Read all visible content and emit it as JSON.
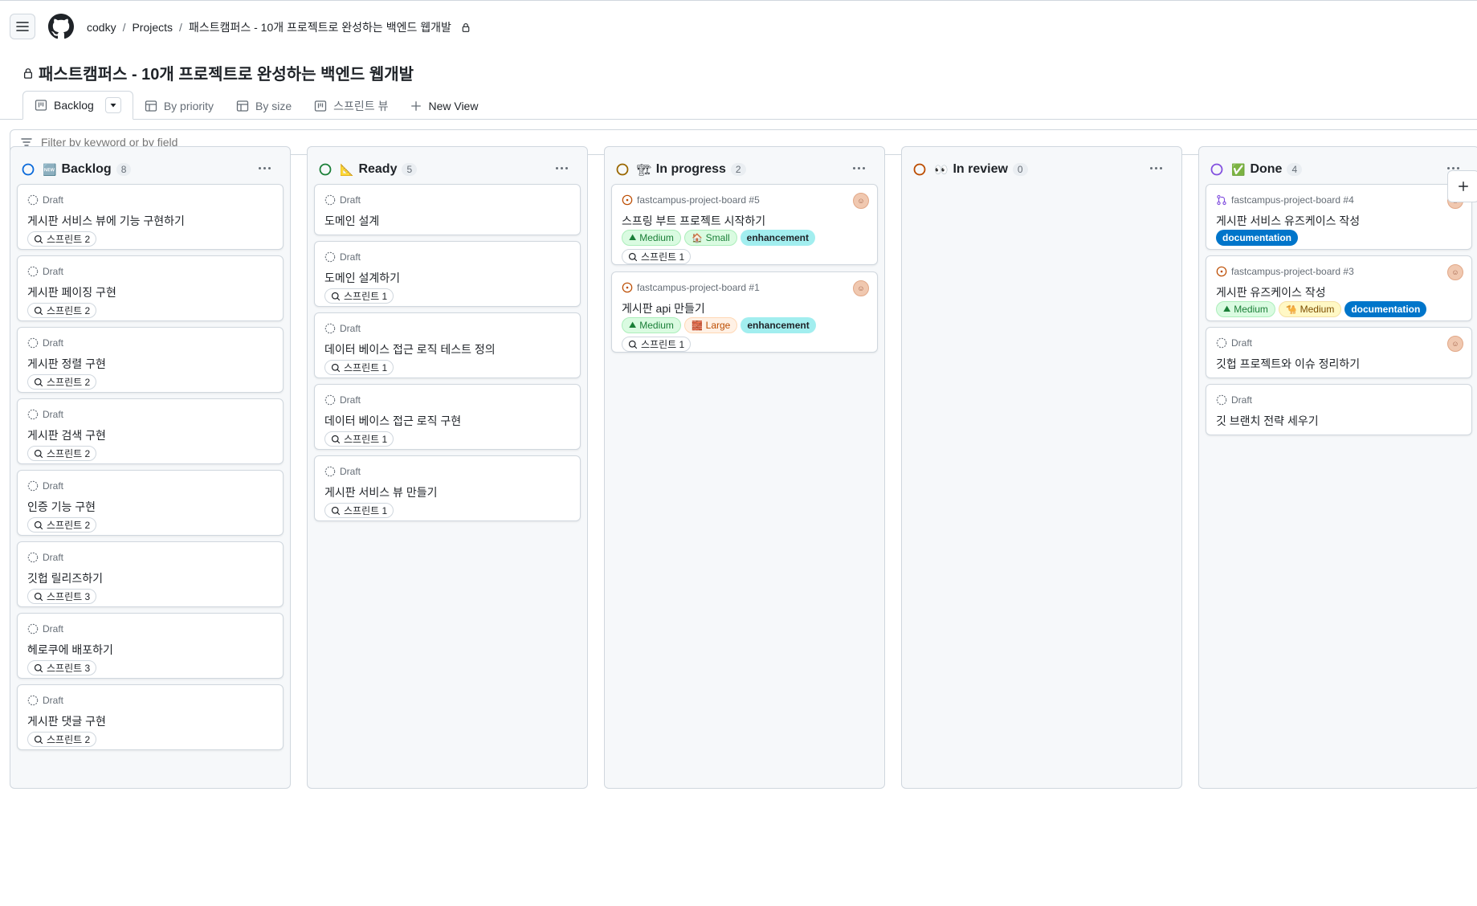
{
  "header": {
    "breadcrumb": [
      "codky",
      "Projects",
      "패스트캠퍼스 - 10개 프로젝트로 완성하는 백엔드 웹개발"
    ]
  },
  "page": {
    "title": "패스트캠퍼스 - 10개 프로젝트로 완성하는 백엔드 웹개발"
  },
  "tabs": [
    {
      "label": "Backlog",
      "icon": "board-icon",
      "active": true
    },
    {
      "label": "By priority",
      "icon": "table-icon"
    },
    {
      "label": "By size",
      "icon": "table-icon"
    },
    {
      "label": "스프린트 뷰",
      "icon": "board-icon"
    },
    {
      "label": "New View",
      "icon": "plus-icon"
    }
  ],
  "filter": {
    "placeholder": "Filter by keyword or by field"
  },
  "columns": [
    {
      "title": "Backlog",
      "count": "8",
      "status_color": "#0969da",
      "emoji": "🆕",
      "cards": [
        {
          "meta": "Draft",
          "title": "게시판 서비스 뷰에 기능 구현하기",
          "iteration": "스프린트 2"
        },
        {
          "meta": "Draft",
          "title": "게시판 페이징 구현",
          "iteration": "스프린트 2"
        },
        {
          "meta": "Draft",
          "title": "게시판 정렬 구현",
          "iteration": "스프린트 2"
        },
        {
          "meta": "Draft",
          "title": "게시판 검색 구현",
          "iteration": "스프린트 2"
        },
        {
          "meta": "Draft",
          "title": "인증 기능 구현",
          "iteration": "스프린트 2"
        },
        {
          "meta": "Draft",
          "title": "깃헙 릴리즈하기",
          "iteration": "스프린트 3"
        },
        {
          "meta": "Draft",
          "title": "헤로쿠에 배포하기",
          "iteration": "스프린트 3"
        },
        {
          "meta": "Draft",
          "title": "게시판 댓글 구현",
          "iteration": "스프린트 2"
        }
      ]
    },
    {
      "title": "Ready",
      "count": "5",
      "status_color": "#1a7f37",
      "emoji": "📐",
      "cards": [
        {
          "meta": "Draft",
          "title": "도메인 설계"
        },
        {
          "meta": "Draft",
          "title": "도메인 설계하기",
          "iteration": "스프린트 1"
        },
        {
          "meta": "Draft",
          "title": "데이터 베이스 접근 로직 테스트 정의",
          "iteration": "스프린트 1"
        },
        {
          "meta": "Draft",
          "title": "데이터 베이스 접근 로직 구현",
          "iteration": "스프린트 1"
        },
        {
          "meta": "Draft",
          "title": "게시판 서비스 뷰 만들기",
          "iteration": "스프린트 1"
        }
      ]
    },
    {
      "title": "In progress",
      "count": "2",
      "status_color": "#9a6700",
      "emoji": "🏗",
      "cards": [
        {
          "meta": "fastcampus-project-board #5",
          "title": "스프링 부트 프로젝트 시작하기",
          "iteration": "스프린트 1",
          "labels": [
            {
              "text": "Medium",
              "kind": "med-green",
              "emoji": "⛰"
            },
            {
              "text": "Small",
              "kind": "small",
              "emoji": "🏠"
            },
            {
              "text": "enhancement",
              "kind": "enh"
            }
          ]
        },
        {
          "meta": "fastcampus-project-board #1",
          "title": "게시판 api 만들기",
          "iteration": "스프린트 1",
          "labels": [
            {
              "text": "Medium",
              "kind": "med-green",
              "emoji": "⛰"
            },
            {
              "text": "Large",
              "kind": "large",
              "emoji": "🧱"
            },
            {
              "text": "enhancement",
              "kind": "enh"
            }
          ]
        }
      ]
    },
    {
      "title": "In review",
      "count": "0",
      "status_color": "#bc4c00",
      "emoji": "👀",
      "cards": []
    },
    {
      "title": "Done",
      "count": "4",
      "status_color": "#8250df",
      "emoji": "✅",
      "cards": [
        {
          "meta": "fastcampus-project-board #4",
          "title": "게시판 서비스 유즈케이스 작성",
          "labels": [
            {
              "text": "documentation",
              "kind": "doc"
            }
          ]
        },
        {
          "meta": "fastcampus-project-board #3",
          "title": "게시판 유즈케이스 작성",
          "labels": [
            {
              "text": "Medium",
              "kind": "med-green",
              "emoji": "⛰"
            },
            {
              "text": "Medium",
              "kind": "med-yellow",
              "emoji": "🐪"
            },
            {
              "text": "documentation",
              "kind": "doc"
            }
          ]
        },
        {
          "meta": "Draft",
          "title": "깃헙 프로젝트와 이슈 정리하기"
        },
        {
          "meta": "Draft",
          "title": "깃 브랜치 전략 세우기"
        }
      ]
    }
  ]
}
